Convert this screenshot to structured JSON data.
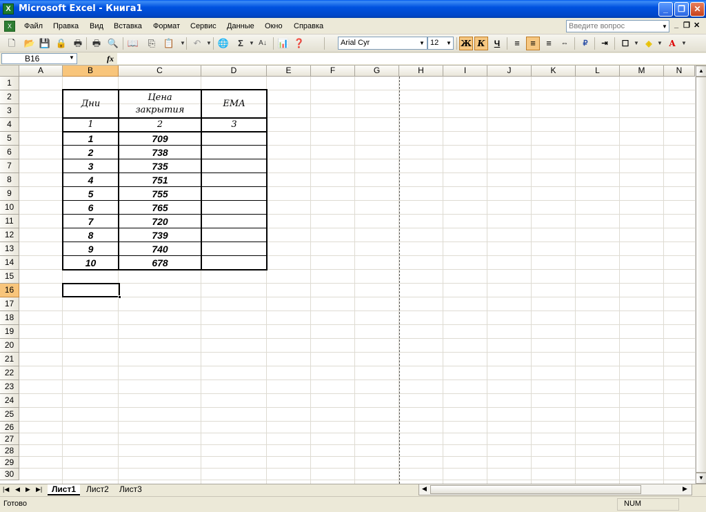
{
  "window": {
    "title": "Microsoft Excel - Книга1"
  },
  "menu": [
    "Файл",
    "Правка",
    "Вид",
    "Вставка",
    "Формат",
    "Сервис",
    "Данные",
    "Окно",
    "Справка"
  ],
  "help_placeholder": "Введите вопрос",
  "font": {
    "name": "Arial Cyr",
    "size": "12"
  },
  "format_buttons": {
    "bold": "Ж",
    "italic": "К",
    "underline": "Ч"
  },
  "namebox": "B16",
  "formula": "",
  "columns": [
    "A",
    "B",
    "C",
    "D",
    "E",
    "F",
    "G",
    "H",
    "I",
    "J",
    "K",
    "L",
    "M",
    "N"
  ],
  "rows": [
    "1",
    "2",
    "3",
    "4",
    "5",
    "6",
    "7",
    "8",
    "9",
    "10",
    "11",
    "12",
    "13",
    "14",
    "15",
    "16",
    "17",
    "18",
    "19",
    "20",
    "21",
    "22",
    "23",
    "24",
    "25",
    "26",
    "27",
    "28",
    "29",
    "30"
  ],
  "table": {
    "headers": [
      "Дни",
      "Цена закрытия",
      "EMA"
    ],
    "header_line1": [
      "Дни",
      "Цена",
      "EMA"
    ],
    "header_line2": "закрытия",
    "numbering": [
      "1",
      "2",
      "3"
    ],
    "days": [
      "1",
      "2",
      "3",
      "4",
      "5",
      "6",
      "7",
      "8",
      "9",
      "10"
    ],
    "prices": [
      "709",
      "738",
      "735",
      "751",
      "755",
      "765",
      "720",
      "739",
      "740",
      "678"
    ],
    "ema": [
      "",
      "",
      "",
      "",
      "",
      "",
      "",
      "",
      "",
      ""
    ]
  },
  "sheets": [
    "Лист1",
    "Лист2",
    "Лист3"
  ],
  "status": {
    "text": "Готово",
    "num": "NUM"
  },
  "colors": {
    "title_bar": "#0058ee",
    "selected_header": "#f8c57b",
    "grid_line": "#dedbd2"
  }
}
